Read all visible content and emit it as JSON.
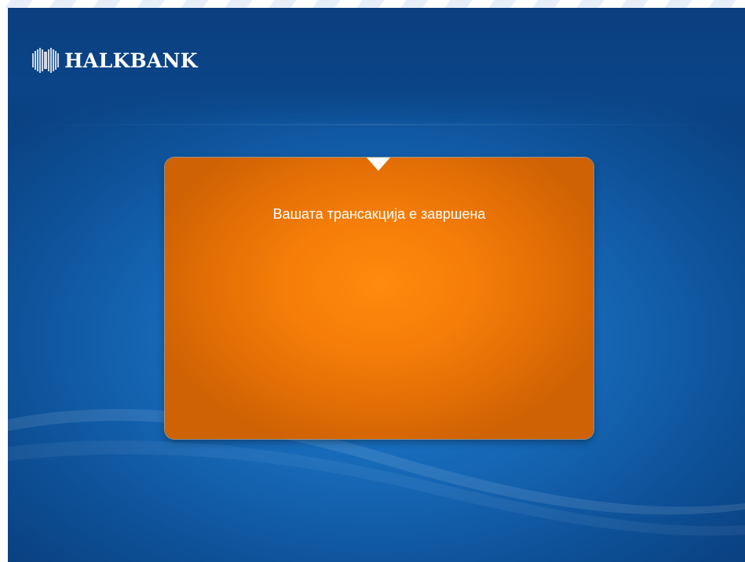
{
  "brand": {
    "name": "HALKBANK",
    "logo_icon": "halkbank-logo-icon",
    "text_color": "#ffffff"
  },
  "message_panel": {
    "text": "Вашата трансакција е завршена",
    "color": "#f57d08"
  },
  "colors": {
    "background": "#1565b3",
    "header": "#0a3f7f"
  }
}
